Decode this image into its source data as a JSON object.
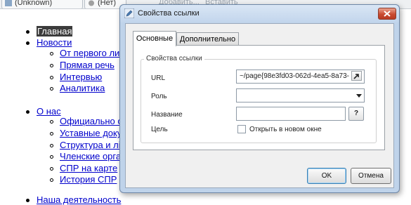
{
  "toolbar": {
    "item1_label": "(Unknown)",
    "item2_label": "(Нет)",
    "faded1_label": "Добавить...",
    "faded2_label": "Вставить"
  },
  "page_list": {
    "selected_item": "Главная",
    "items": [
      {
        "label": "Новости",
        "children": [
          "От первого ли",
          "Прямая речь",
          "Интервью",
          "Аналитика"
        ]
      },
      {
        "label": "О нас",
        "children": [
          "Официально о",
          "Уставные доку",
          "Структура и лі",
          "Членские орга",
          "СПР на карте",
          "История СПР"
        ]
      },
      {
        "label": "Наша деятельность",
        "children": []
      }
    ]
  },
  "dialog": {
    "title": "Свойства ссылки",
    "tabs": [
      "Основные",
      "Дополнительно"
    ],
    "active_tab": "Основные",
    "fieldset_legend": "Свойства ссылки",
    "fields": {
      "url_label": "URL",
      "url_value": "~/page{98e3fd03-062d-4ea5-8a73-",
      "role_label": "Роль",
      "role_value": "",
      "name_label": "Название",
      "name_value": "",
      "help_label": "?",
      "target_label": "Цель",
      "new_window_label": "Открыть в новом окне",
      "new_window_checked": false
    },
    "buttons": {
      "ok": "OK",
      "cancel": "Отмена"
    }
  },
  "colors": {
    "link": "#0000cc",
    "dialog_frame": "#bfd3ea",
    "close_button": "#c94b32"
  }
}
